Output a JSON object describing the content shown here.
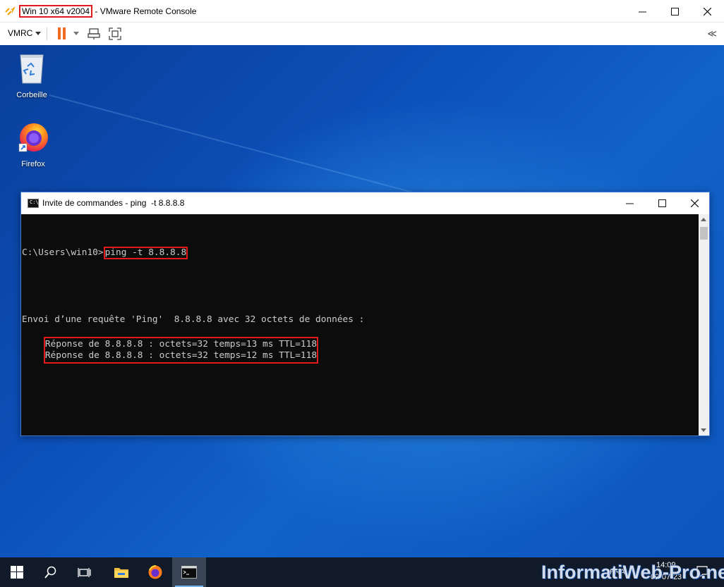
{
  "vmrc": {
    "title_highlight": "Win 10 x64 v2004",
    "title_rest": " - VMware Remote Console",
    "menu_label": "VMRC",
    "colors": {
      "pause": "#f26b21",
      "highlight": "#e3191b",
      "logo": "#f4a000"
    }
  },
  "desktop": {
    "icons": [
      {
        "label": "Corbeille",
        "icon": "recycle-bin-icon"
      },
      {
        "label": "Firefox",
        "icon": "firefox-icon"
      }
    ]
  },
  "cmd": {
    "title": "Invite de commandes - ping  -t 8.8.8.8",
    "prompt": "C:\\Users\\win10>",
    "command": "ping -t 8.8.8.8",
    "sending": "Envoi d’une requête 'Ping'  8.8.8.8 avec 32 octets de données :",
    "replies": [
      "Réponse de 8.8.8.8 : octets=32 temps=13 ms TTL=118",
      "Réponse de 8.8.8.8 : octets=32 temps=12 ms TTL=118"
    ]
  },
  "taskbar": {
    "tray": {
      "language": "FRA",
      "time": "14:09",
      "date": "02-07-23"
    }
  },
  "watermark": "InformatiWeb-Pro.net"
}
